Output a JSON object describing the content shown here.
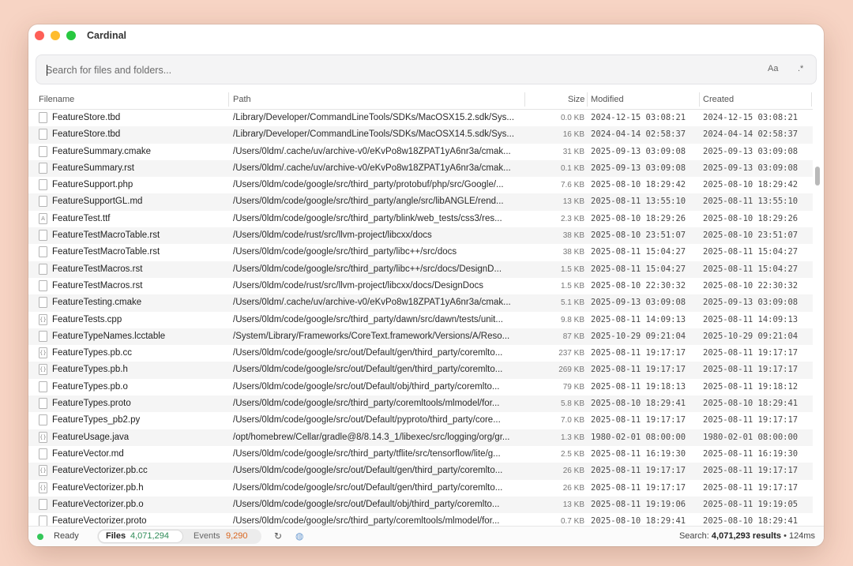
{
  "window": {
    "title": "Cardinal"
  },
  "search": {
    "placeholder": "Search for files and folders...",
    "case_label": "Aa",
    "regex_label": ".*"
  },
  "columns": {
    "filename": "Filename",
    "path": "Path",
    "size": "Size",
    "modified": "Modified",
    "created": "Created"
  },
  "rows": [
    {
      "icon": "doc",
      "name": "FeatureStore.tbd",
      "path": "/Library/Developer/CommandLineTools/SDKs/MacOSX15.2.sdk/Sys...",
      "size": "0.0 KB",
      "modified": "2024-12-15 03:08:21",
      "created": "2024-12-15 03:08:21"
    },
    {
      "icon": "doc",
      "name": "FeatureStore.tbd",
      "path": "/Library/Developer/CommandLineTools/SDKs/MacOSX14.5.sdk/Sys...",
      "size": "16 KB",
      "modified": "2024-04-14 02:58:37",
      "created": "2024-04-14 02:58:37"
    },
    {
      "icon": "doc",
      "name": "FeatureSummary.cmake",
      "path": "/Users/0ldm/.cache/uv/archive-v0/eKvPo8w18ZPAT1yA6nr3a/cmak...",
      "size": "31 KB",
      "modified": "2025-09-13 03:09:08",
      "created": "2025-09-13 03:09:08"
    },
    {
      "icon": "doc",
      "name": "FeatureSummary.rst",
      "path": "/Users/0ldm/.cache/uv/archive-v0/eKvPo8w18ZPAT1yA6nr3a/cmak...",
      "size": "0.1 KB",
      "modified": "2025-09-13 03:09:08",
      "created": "2025-09-13 03:09:08"
    },
    {
      "icon": "doc",
      "name": "FeatureSupport.php",
      "path": "/Users/0ldm/code/google/src/third_party/protobuf/php/src/Google/...",
      "size": "7.6 KB",
      "modified": "2025-08-10 18:29:42",
      "created": "2025-08-10 18:29:42"
    },
    {
      "icon": "doc",
      "name": "FeatureSupportGL.md",
      "path": "/Users/0ldm/code/google/src/third_party/angle/src/libANGLE/rend...",
      "size": "13 KB",
      "modified": "2025-08-11 13:55:10",
      "created": "2025-08-11 13:55:10"
    },
    {
      "icon": "font",
      "name": "FeatureTest.ttf",
      "path": "/Users/0ldm/code/google/src/third_party/blink/web_tests/css3/res...",
      "size": "2.3 KB",
      "modified": "2025-08-10 18:29:26",
      "created": "2025-08-10 18:29:26"
    },
    {
      "icon": "doc",
      "name": "FeatureTestMacroTable.rst",
      "path": "/Users/0ldm/code/rust/src/llvm-project/libcxx/docs",
      "size": "38 KB",
      "modified": "2025-08-10 23:51:07",
      "created": "2025-08-10 23:51:07"
    },
    {
      "icon": "doc",
      "name": "FeatureTestMacroTable.rst",
      "path": "/Users/0ldm/code/google/src/third_party/libc++/src/docs",
      "size": "38 KB",
      "modified": "2025-08-11 15:04:27",
      "created": "2025-08-11 15:04:27"
    },
    {
      "icon": "doc",
      "name": "FeatureTestMacros.rst",
      "path": "/Users/0ldm/code/google/src/third_party/libc++/src/docs/DesignD...",
      "size": "1.5 KB",
      "modified": "2025-08-11 15:04:27",
      "created": "2025-08-11 15:04:27"
    },
    {
      "icon": "doc",
      "name": "FeatureTestMacros.rst",
      "path": "/Users/0ldm/code/rust/src/llvm-project/libcxx/docs/DesignDocs",
      "size": "1.5 KB",
      "modified": "2025-08-10 22:30:32",
      "created": "2025-08-10 22:30:32"
    },
    {
      "icon": "doc",
      "name": "FeatureTesting.cmake",
      "path": "/Users/0ldm/.cache/uv/archive-v0/eKvPo8w18ZPAT1yA6nr3a/cmak...",
      "size": "5.1 KB",
      "modified": "2025-09-13 03:09:08",
      "created": "2025-09-13 03:09:08"
    },
    {
      "icon": "code",
      "name": "FeatureTests.cpp",
      "path": "/Users/0ldm/code/google/src/third_party/dawn/src/dawn/tests/unit...",
      "size": "9.8 KB",
      "modified": "2025-08-11 14:09:13",
      "created": "2025-08-11 14:09:13"
    },
    {
      "icon": "doc",
      "name": "FeatureTypeNames.lcctable",
      "path": "/System/Library/Frameworks/CoreText.framework/Versions/A/Reso...",
      "size": "87 KB",
      "modified": "2025-10-29 09:21:04",
      "created": "2025-10-29 09:21:04"
    },
    {
      "icon": "code",
      "name": "FeatureTypes.pb.cc",
      "path": "/Users/0ldm/code/google/src/out/Default/gen/third_party/coremlto...",
      "size": "237 KB",
      "modified": "2025-08-11 19:17:17",
      "created": "2025-08-11 19:17:17"
    },
    {
      "icon": "code",
      "name": "FeatureTypes.pb.h",
      "path": "/Users/0ldm/code/google/src/out/Default/gen/third_party/coremlto...",
      "size": "269 KB",
      "modified": "2025-08-11 19:17:17",
      "created": "2025-08-11 19:17:17"
    },
    {
      "icon": "doc",
      "name": "FeatureTypes.pb.o",
      "path": "/Users/0ldm/code/google/src/out/Default/obj/third_party/coremlto...",
      "size": "79 KB",
      "modified": "2025-08-11 19:18:13",
      "created": "2025-08-11 19:18:12"
    },
    {
      "icon": "doc",
      "name": "FeatureTypes.proto",
      "path": "/Users/0ldm/code/google/src/third_party/coremltools/mlmodel/for...",
      "size": "5.8 KB",
      "modified": "2025-08-10 18:29:41",
      "created": "2025-08-10 18:29:41"
    },
    {
      "icon": "doc",
      "name": "FeatureTypes_pb2.py",
      "path": "/Users/0ldm/code/google/src/out/Default/pyproto/third_party/core...",
      "size": "7.0 KB",
      "modified": "2025-08-11 19:17:17",
      "created": "2025-08-11 19:17:17"
    },
    {
      "icon": "code",
      "name": "FeatureUsage.java",
      "path": "/opt/homebrew/Cellar/gradle@8/8.14.3_1/libexec/src/logging/org/gr...",
      "size": "1.3 KB",
      "modified": "1980-02-01 08:00:00",
      "created": "1980-02-01 08:00:00"
    },
    {
      "icon": "doc",
      "name": "FeatureVector.md",
      "path": "/Users/0ldm/code/google/src/third_party/tflite/src/tensorflow/lite/g...",
      "size": "2.5 KB",
      "modified": "2025-08-11 16:19:30",
      "created": "2025-08-11 16:19:30"
    },
    {
      "icon": "code",
      "name": "FeatureVectorizer.pb.cc",
      "path": "/Users/0ldm/code/google/src/out/Default/gen/third_party/coremlto...",
      "size": "26 KB",
      "modified": "2025-08-11 19:17:17",
      "created": "2025-08-11 19:17:17"
    },
    {
      "icon": "code",
      "name": "FeatureVectorizer.pb.h",
      "path": "/Users/0ldm/code/google/src/out/Default/gen/third_party/coremlto...",
      "size": "26 KB",
      "modified": "2025-08-11 19:17:17",
      "created": "2025-08-11 19:17:17"
    },
    {
      "icon": "doc",
      "name": "FeatureVectorizer.pb.o",
      "path": "/Users/0ldm/code/google/src/out/Default/obj/third_party/coremlto...",
      "size": "13 KB",
      "modified": "2025-08-11 19:19:06",
      "created": "2025-08-11 19:19:05"
    },
    {
      "icon": "doc",
      "name": "FeatureVectorizer.proto",
      "path": "/Users/0ldm/code/google/src/third_party/coremltools/mlmodel/for...",
      "size": "0.7 KB",
      "modified": "2025-08-10 18:29:41",
      "created": "2025-08-10 18:29:41"
    }
  ],
  "footer": {
    "status": "Ready",
    "files_label": "Files",
    "files_count": "4,071,294",
    "events_label": "Events",
    "events_count": "9,290",
    "summary_prefix": "Search:",
    "summary_results": "4,071,293 results",
    "summary_time": "• 124ms"
  },
  "colors": {
    "accent_green": "#2e8b57",
    "accent_orange": "#d9651e",
    "status_ready": "#34c759"
  }
}
